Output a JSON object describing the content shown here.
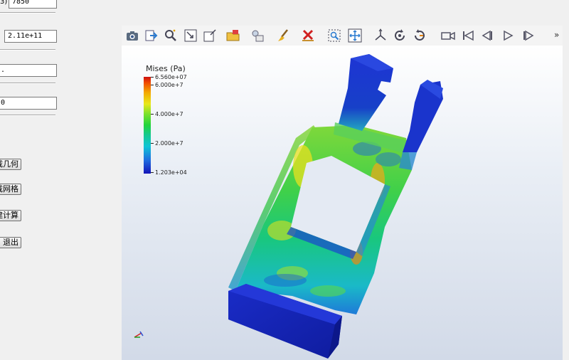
{
  "left_panel": {
    "fields": [
      {
        "name": "density-field",
        "label": "3)",
        "value": "7850"
      },
      {
        "name": "youngs-modulus-field",
        "label": "",
        "value": "2.11e+11"
      },
      {
        "name": "poisson-field",
        "label": "",
        "value": "."
      },
      {
        "name": "load-field",
        "label": "",
        "value": "0"
      }
    ],
    "buttons": {
      "load_geometry": "载几何",
      "load_mesh": "载网格",
      "run_compute": "建计算",
      "exit": "退出"
    }
  },
  "toolbar": {
    "icons": [
      "camera-icon",
      "export-icon",
      "zoom-data-icon",
      "zoom-box-icon",
      "reset-view-icon",
      "open-file-icon",
      "source-icon",
      "clear-icon",
      "delete-icon",
      "select-icon",
      "pan-icon",
      "axes-icon",
      "rotate-ccw-icon",
      "rotate-cw-icon",
      "record-icon",
      "first-frame-icon",
      "prev-frame-icon",
      "play-icon",
      "last-frame-icon"
    ],
    "more": "»"
  },
  "colorbar": {
    "title": "Mises (Pa)",
    "ticks": [
      {
        "label": "6.560e+07"
      },
      {
        "label": "6.000e+7"
      },
      {
        "label": "4.000e+7"
      },
      {
        "label": "2.000e+7"
      },
      {
        "label": "1.203e+04"
      }
    ]
  },
  "colors": {
    "accent": "#1f6de0",
    "max": "#cc1111",
    "min": "#1414b8"
  }
}
